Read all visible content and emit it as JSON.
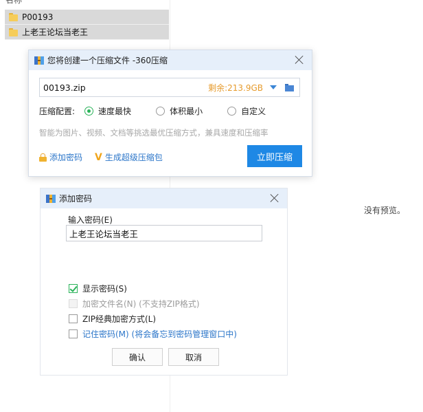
{
  "explorer": {
    "top_label": "名称",
    "files": [
      {
        "name": "P00193",
        "icon": "folder-icon"
      },
      {
        "name": "上老王论坛当老王",
        "icon": "folder-icon"
      }
    ],
    "preview_text": "没有预览。"
  },
  "compress_dialog": {
    "title": "您将创建一个压缩文件 -360压缩",
    "file_name": "00193.zip",
    "free_space": "剩余:213.9GB",
    "config_label": "压缩配置:",
    "options": [
      {
        "label": "速度最快",
        "selected": true
      },
      {
        "label": "体积最小",
        "selected": false
      },
      {
        "label": "自定义",
        "selected": false
      }
    ],
    "hint": "智能为图片、视频、文档等挑选最优压缩方式，兼具速度和压缩率",
    "add_password_link": "添加密码",
    "super_package_link": "生成超级压缩包",
    "compress_button": "立即压缩",
    "accent_color": "#1e88e5"
  },
  "password_dialog": {
    "title": "添加密码",
    "input_label": "输入密码(E)",
    "password_value": "上老王论坛当老王",
    "checkboxes": [
      {
        "label": "显示密码(S)",
        "checked": true,
        "enabled": true
      },
      {
        "label": "加密文件名(N) (不支持ZIP格式)",
        "checked": false,
        "enabled": false
      },
      {
        "label": "ZIP经典加密方式(L)",
        "checked": false,
        "enabled": true
      },
      {
        "label": "记住密码(M) (将会备忘到密码管理窗口中)",
        "checked": false,
        "enabled": true
      }
    ],
    "ok_button": "确认",
    "cancel_button": "取消"
  }
}
